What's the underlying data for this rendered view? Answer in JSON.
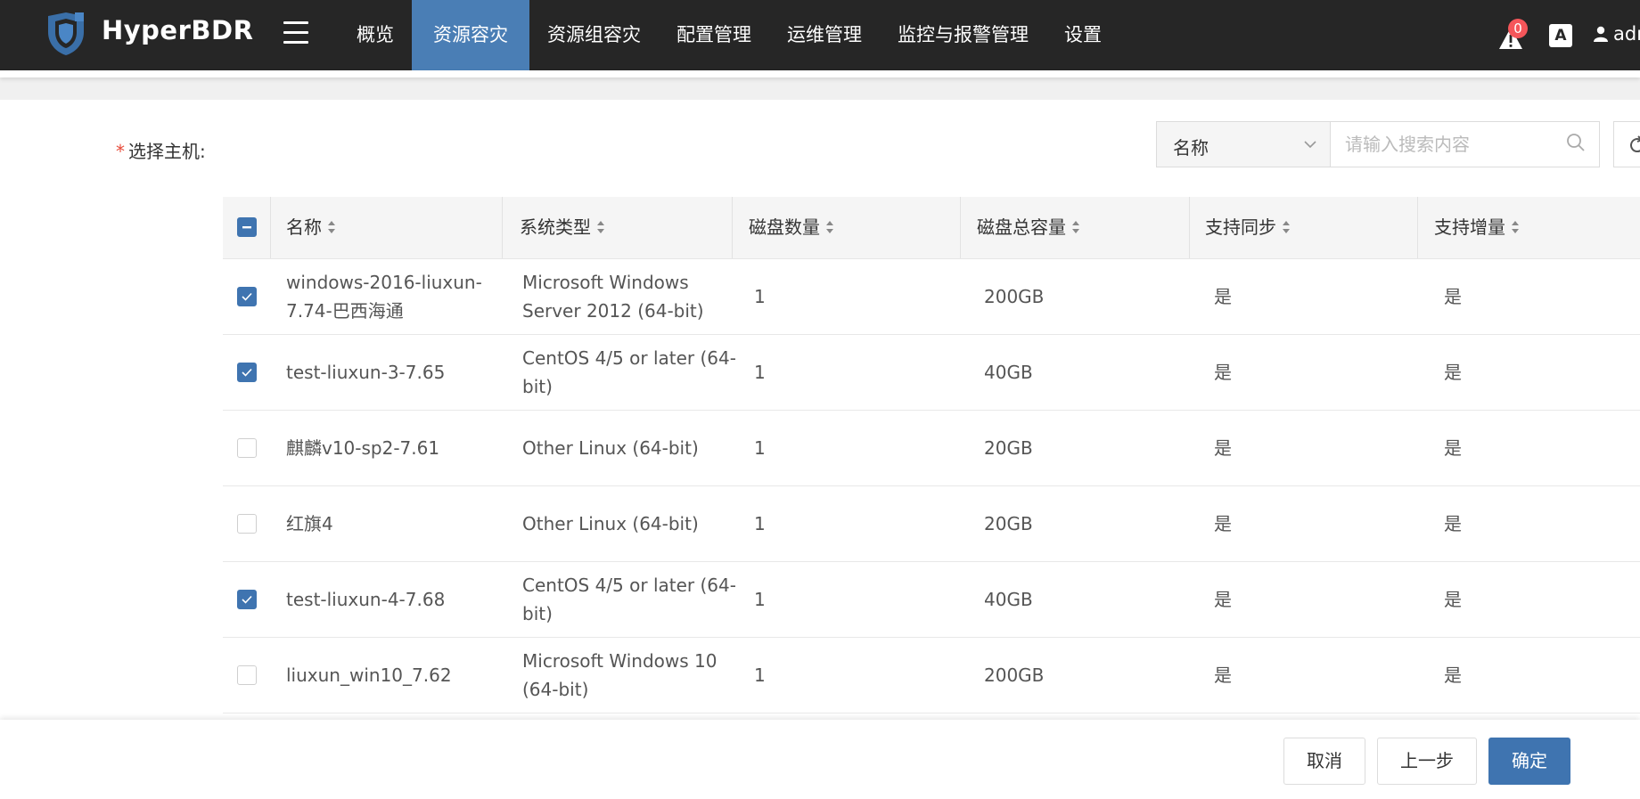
{
  "header": {
    "brand": "HyperBDR",
    "nav": [
      {
        "label": "概览",
        "active": false
      },
      {
        "label": "资源容灾",
        "active": true
      },
      {
        "label": "资源组容灾",
        "active": false
      },
      {
        "label": "配置管理",
        "active": false
      },
      {
        "label": "运维管理",
        "active": false
      },
      {
        "label": "监控与报警管理",
        "active": false
      },
      {
        "label": "设置",
        "active": false
      }
    ],
    "alert_count": "0",
    "lang_icon_text": "A",
    "user": "admin"
  },
  "form": {
    "required_mark": "*",
    "label": "选择主机:"
  },
  "search": {
    "field_selected": "名称",
    "placeholder": "请输入搜索内容"
  },
  "table": {
    "columns": [
      "名称",
      "系统类型",
      "磁盘数量",
      "磁盘总容量",
      "支持同步",
      "支持增量"
    ],
    "select_all_state": "indeterminate",
    "rows": [
      {
        "checked": true,
        "name_l1": "windows-2016-liuxun-",
        "name_l2": "7.74-巴西海通",
        "os_l1": "Microsoft Windows",
        "os_l2": "Server 2012 (64-bit)",
        "disks": "1",
        "capacity": "200GB",
        "sync": "是",
        "incr": "是"
      },
      {
        "checked": true,
        "name_l1": "test-liuxun-3-7.65",
        "name_l2": "",
        "os_l1": "CentOS 4/5 or later (64-",
        "os_l2": "bit)",
        "disks": "1",
        "capacity": "40GB",
        "sync": "是",
        "incr": "是"
      },
      {
        "checked": false,
        "name_l1": "麒麟v10-sp2-7.61",
        "name_l2": "",
        "os_l1": "Other Linux (64-bit)",
        "os_l2": "",
        "disks": "1",
        "capacity": "20GB",
        "sync": "是",
        "incr": "是"
      },
      {
        "checked": false,
        "name_l1": "红旗4",
        "name_l2": "",
        "os_l1": "Other Linux (64-bit)",
        "os_l2": "",
        "disks": "1",
        "capacity": "20GB",
        "sync": "是",
        "incr": "是"
      },
      {
        "checked": true,
        "name_l1": "test-liuxun-4-7.68",
        "name_l2": "",
        "os_l1": "CentOS 4/5 or later (64-",
        "os_l2": "bit)",
        "disks": "1",
        "capacity": "40GB",
        "sync": "是",
        "incr": "是"
      },
      {
        "checked": false,
        "name_l1": "liuxun_win10_7.62",
        "name_l2": "",
        "os_l1": "Microsoft Windows 10",
        "os_l2": "(64-bit)",
        "disks": "1",
        "capacity": "200GB",
        "sync": "是",
        "incr": "是"
      }
    ]
  },
  "footer": {
    "cancel": "取消",
    "prev": "上一步",
    "confirm": "确定"
  },
  "colors": {
    "nav_bg": "#262626",
    "accent": "#3f74b0",
    "nav_active": "#4a7eb5",
    "badge": "#f5565a"
  },
  "icons": [
    "shield-logo-icon",
    "menu-icon",
    "alert-icon",
    "language-icon",
    "user-icon",
    "chevron-down-icon",
    "search-icon",
    "refresh-icon",
    "sort-icon",
    "check-icon"
  ]
}
